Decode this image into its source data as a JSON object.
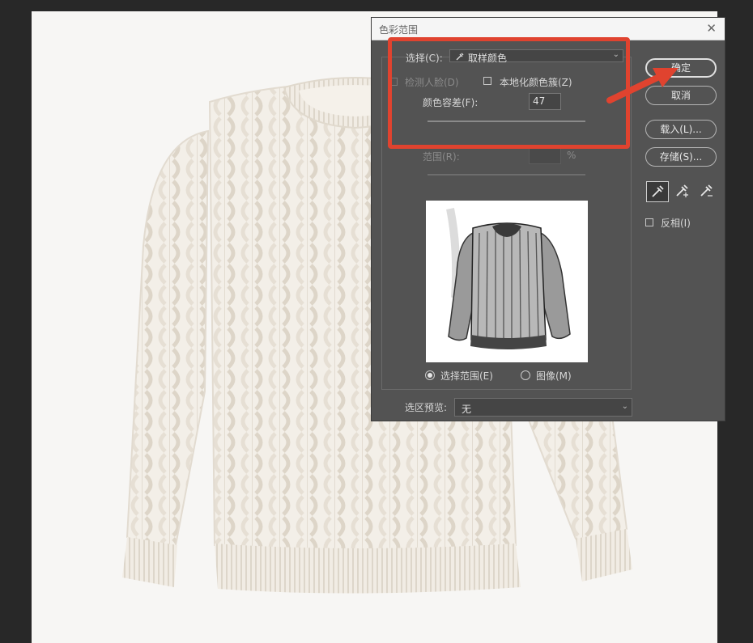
{
  "dialog": {
    "title": "色彩范围",
    "select": {
      "label": "选择(C):",
      "value": "取样颜色"
    },
    "detect_faces": {
      "label": "检测人脸(D)",
      "checked": false
    },
    "localized_clusters": {
      "label": "本地化颜色簇(Z)",
      "checked": false
    },
    "fuzziness": {
      "label": "颜色容差(F):",
      "value": "47",
      "slider_fraction": 0.23
    },
    "range": {
      "label": "范围(R):",
      "value": "",
      "unit": "%"
    },
    "view": {
      "selection_label": "选择范围(E)",
      "image_label": "图像(M)",
      "selected": "selection"
    },
    "selection_preview": {
      "label": "选区预览:",
      "value": "无"
    },
    "invert": {
      "label": "反相(I)",
      "checked": false
    },
    "buttons": {
      "ok": "确定",
      "cancel": "取消",
      "load": "载入(L)...",
      "save": "存储(S)..."
    }
  },
  "annotation": {
    "color": "#e0432f"
  }
}
